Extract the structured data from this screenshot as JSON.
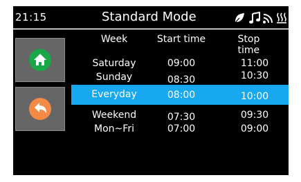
{
  "status_bar": {
    "time": "21:15",
    "title": "Standard Mode",
    "icons": [
      "leaf-icon",
      "music-note-icon",
      "wifi-icon",
      "heater-icon"
    ]
  },
  "side_buttons": [
    {
      "name": "home-button",
      "icon": "home-icon",
      "color": "#18a848"
    },
    {
      "name": "back-button",
      "icon": "back-arrow-icon",
      "color": "#f58a45"
    }
  ],
  "table": {
    "headers": [
      "Week",
      "Start time",
      "Stop time"
    ],
    "rows": [
      {
        "week": "Saturday",
        "start": "09:00",
        "stop": "11:00"
      },
      {
        "week": "Sunday",
        "start": "08:30",
        "stop": "10:30"
      },
      {
        "week": "Everyday",
        "start": "08:00",
        "stop": "10:00",
        "selected": true
      },
      {
        "week": "Weekend",
        "start": "07:30",
        "stop": "09:30"
      },
      {
        "week": "Mon~Fri",
        "start": "07:00",
        "stop": "09:00"
      }
    ]
  },
  "colors": {
    "background": "#000000",
    "highlight": "#18a8f0",
    "text": "#ffffff",
    "button_bg": "#666666"
  }
}
